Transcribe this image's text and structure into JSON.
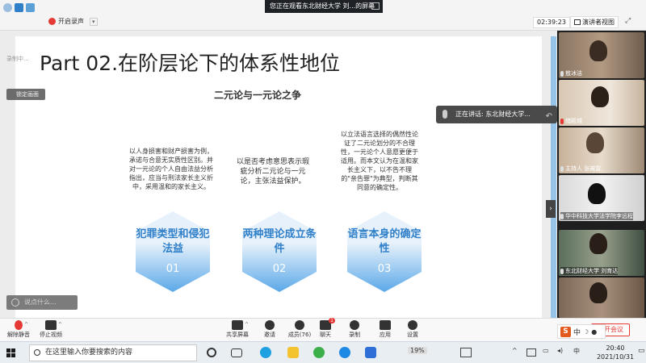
{
  "top_bar": {
    "share_banner": "您正在观看东北财经大学 刘...的屏幕",
    "icons": [
      "info-icon",
      "shield-icon",
      "grid-icon"
    ]
  },
  "sub_bar": {
    "recording_label": "开启录声",
    "timer": "02:39:23",
    "speaker_view_label": "演讲者视图",
    "local_record_tag": "录制中..."
  },
  "slide": {
    "title": "Part 02.在阶层论下的体系性地位",
    "subtitle": "二元论与一元论之争",
    "columns": [
      {
        "text": "以人身损害和财产损害为例，承诺与合意无实质性区别。并对一元论的个人自由法益分析指出，应当与刑法家长主义折中，采用温和的家长主义。",
        "hex_label": "犯罪类型和侵犯法益",
        "num": "01"
      },
      {
        "text": "以是否考虑意思表示瑕疵分析二元论与一元论，主张法益保护。",
        "hex_label": "两种理论成立条件",
        "num": "02"
      },
      {
        "text": "以立法语言选择的偶然性论证了二元论划分的不合理性，一元论个人意愿更便于适用。而本文认为在温和家长主义下，以不告不理的\"亲告罪\"为典型，判断其同意的确定性。",
        "hex_label": "语言本身的确定性",
        "num": "03"
      }
    ]
  },
  "overlays": {
    "pin_tip": "锁定画面",
    "speaking_tip": "正在讲话: 东北财经大学...",
    "say_placeholder": "说点什么...",
    "collapse_arrow": "›"
  },
  "participants": [
    {
      "name": "敖冰洁",
      "muted": false
    },
    {
      "name": "储殿城",
      "muted": true
    },
    {
      "name": "主持人 张被雷",
      "muted": false
    },
    {
      "name": "华中科技大学法学院李远程",
      "muted": false
    },
    {
      "name": "东北财经大学 刘育达",
      "muted": false
    },
    {
      "name": "",
      "muted": false
    }
  ],
  "toolbar": {
    "unmute": "解除静音",
    "stop_video": "停止视频",
    "share_screen": "共享屏幕",
    "invite": "邀请",
    "members": "成员(76)",
    "chat": "聊天",
    "chat_badge": "1",
    "record": "录制",
    "apps": "应用",
    "settings": "设置",
    "leave": "离开会议",
    "ime": "中"
  },
  "taskbar": {
    "search_placeholder": "在这里输入你要搜索的内容",
    "battery": "19%",
    "time": "20:40",
    "date": "2021/10/31"
  },
  "colors": {
    "accent_blue": "#2f7fc9",
    "slide_bar": "#96c4e8",
    "leave_red": "#e53935"
  }
}
